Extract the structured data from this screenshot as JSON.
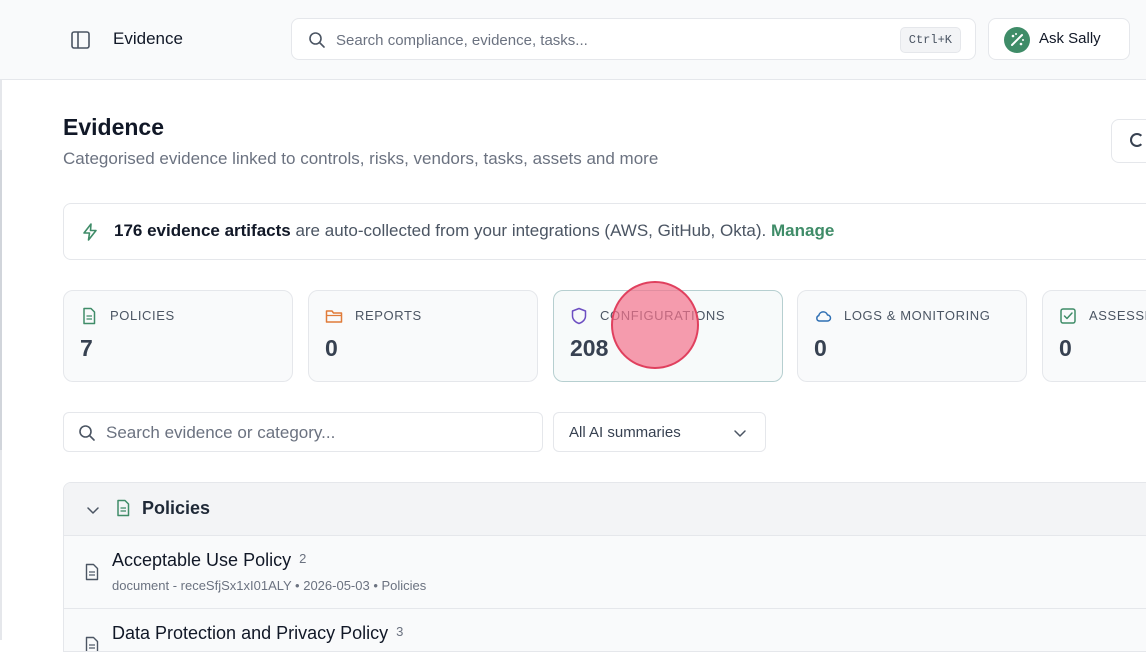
{
  "topbar": {
    "title": "Evidence",
    "search_placeholder": "Search compliance, evidence, tasks...",
    "search_shortcut": "Ctrl+K",
    "ask_label": "Ask Sally"
  },
  "header": {
    "title": "Evidence",
    "subtitle": "Categorised evidence linked to controls, risks, vendors, tasks, assets and more"
  },
  "banner": {
    "count_text": "176 evidence artifacts",
    "rest_text": " are auto-collected from your integrations (AWS, GitHub, Okta). ",
    "link_text": "Manage"
  },
  "stats": [
    {
      "label": "POLICIES",
      "value": "7",
      "icon": "document-icon",
      "color": "#3f8c68"
    },
    {
      "label": "REPORTS",
      "value": "0",
      "icon": "folder-icon",
      "color": "#e07b39"
    },
    {
      "label": "CONFIGURATIONS",
      "value": "208",
      "icon": "shield-icon",
      "color": "#6d4fc2"
    },
    {
      "label": "LOGS & MONITORING",
      "value": "0",
      "icon": "cloud-icon",
      "color": "#2f6fb3"
    },
    {
      "label": "ASSESSMENTS",
      "value": "0",
      "icon": "checkbox-icon",
      "color": "#3f8c68"
    }
  ],
  "filters": {
    "search_placeholder": "Search evidence or category...",
    "summary_select": "All AI summaries"
  },
  "group": {
    "title": "Policies",
    "items": [
      {
        "title": "Acceptable Use Policy",
        "count": "2",
        "meta": "document - receSfjSx1xI01ALY • 2026-05-03 • Policies"
      },
      {
        "title": "Data Protection and Privacy Policy",
        "count": "3",
        "meta": ""
      }
    ]
  },
  "colors": {
    "accent_green": "#3f8c68",
    "click_marker": "#f4728c"
  }
}
